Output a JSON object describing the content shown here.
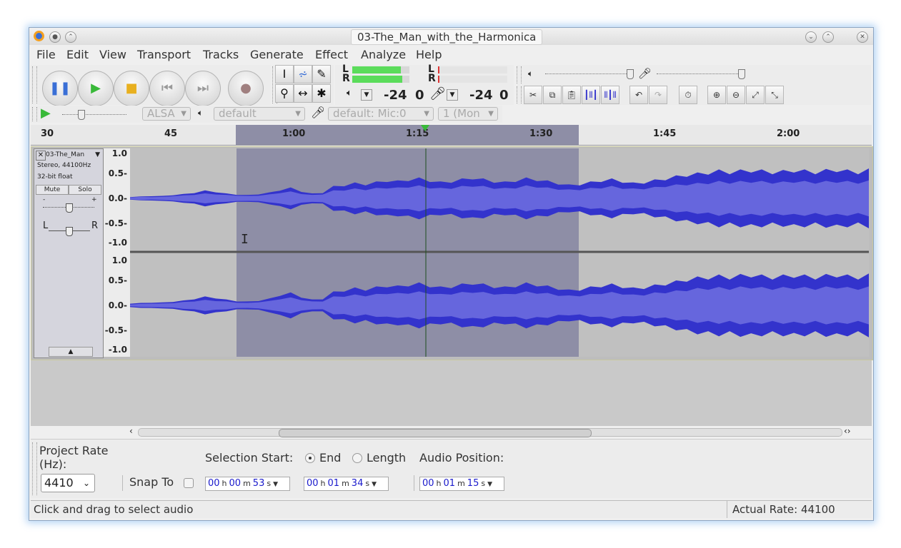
{
  "window": {
    "title": "03-The_Man_with_the_Harmonica"
  },
  "menu": [
    "File",
    "Edit",
    "View",
    "Transport",
    "Tracks",
    "Generate",
    "Effect",
    "Analyze",
    "Help"
  ],
  "meters": {
    "rec_l": "L",
    "rec_r": "R",
    "play_l": "L",
    "play_r": "R",
    "rec_db": "-24",
    "rec_zero": "0",
    "play_db": "-24",
    "play_zero": "0"
  },
  "device": {
    "host": "ALSA",
    "output": "default",
    "input": "default: Mic:0",
    "channels": "1 (Mon"
  },
  "ruler": {
    "ticks": [
      "30",
      "45",
      "1:00",
      "1:15",
      "1:30",
      "1:45",
      "2:00"
    ]
  },
  "track": {
    "name": "03-The_Man",
    "info1": "Stereo, 44100Hz",
    "info2": "32-bit float",
    "mute": "Mute",
    "solo": "Solo",
    "gain_minus": "-",
    "gain_plus": "+",
    "pan_l": "L",
    "pan_r": "R",
    "scale": [
      "1.0",
      "0.5-",
      "0.0-",
      "-0.5-",
      "-1.0"
    ],
    "channels": [
      {
        "peaks": [
          0.03,
          0.04,
          0.05,
          0.05,
          0.07,
          0.09,
          0.12,
          0.16,
          0.14,
          0.1,
          0.08,
          0.07,
          0.09,
          0.12,
          0.18,
          0.22,
          0.15,
          0.1,
          0.12,
          0.25,
          0.28,
          0.32,
          0.3,
          0.34,
          0.38,
          0.36,
          0.4,
          0.42,
          0.38,
          0.34,
          0.36,
          0.4,
          0.44,
          0.4,
          0.36,
          0.34,
          0.38,
          0.42,
          0.4,
          0.36,
          0.32,
          0.28,
          0.3,
          0.34,
          0.38,
          0.4,
          0.36,
          0.32,
          0.34,
          0.38,
          0.42,
          0.46,
          0.5,
          0.52,
          0.55,
          0.58,
          0.56,
          0.58,
          0.6,
          0.58,
          0.56,
          0.57,
          0.6,
          0.58,
          0.56,
          0.59,
          0.61,
          0.58,
          0.56,
          0.6
        ],
        "rms": [
          0.02,
          0.03,
          0.03,
          0.03,
          0.05,
          0.06,
          0.08,
          0.1,
          0.09,
          0.07,
          0.06,
          0.05,
          0.06,
          0.08,
          0.12,
          0.14,
          0.1,
          0.07,
          0.09,
          0.16,
          0.18,
          0.2,
          0.19,
          0.21,
          0.23,
          0.22,
          0.25,
          0.26,
          0.23,
          0.21,
          0.22,
          0.25,
          0.27,
          0.25,
          0.22,
          0.21,
          0.23,
          0.26,
          0.25,
          0.22,
          0.2,
          0.18,
          0.19,
          0.21,
          0.23,
          0.25,
          0.22,
          0.2,
          0.21,
          0.23,
          0.26,
          0.28,
          0.3,
          0.31,
          0.33,
          0.35,
          0.34,
          0.35,
          0.36,
          0.35,
          0.34,
          0.34,
          0.36,
          0.35,
          0.34,
          0.35,
          0.36,
          0.35,
          0.34,
          0.36
        ]
      },
      {
        "peaks": [
          0.04,
          0.05,
          0.06,
          0.06,
          0.08,
          0.1,
          0.14,
          0.18,
          0.16,
          0.12,
          0.09,
          0.08,
          0.1,
          0.14,
          0.22,
          0.26,
          0.18,
          0.12,
          0.14,
          0.28,
          0.32,
          0.36,
          0.34,
          0.38,
          0.42,
          0.4,
          0.44,
          0.46,
          0.42,
          0.38,
          0.4,
          0.44,
          0.48,
          0.44,
          0.4,
          0.38,
          0.42,
          0.46,
          0.44,
          0.4,
          0.36,
          0.32,
          0.34,
          0.38,
          0.42,
          0.44,
          0.4,
          0.36,
          0.38,
          0.42,
          0.46,
          0.5,
          0.55,
          0.58,
          0.6,
          0.62,
          0.6,
          0.63,
          0.65,
          0.62,
          0.6,
          0.62,
          0.64,
          0.62,
          0.6,
          0.63,
          0.65,
          0.62,
          0.6,
          0.64
        ],
        "rms": [
          0.02,
          0.03,
          0.04,
          0.04,
          0.05,
          0.07,
          0.09,
          0.11,
          0.1,
          0.08,
          0.06,
          0.05,
          0.07,
          0.09,
          0.14,
          0.16,
          0.12,
          0.08,
          0.09,
          0.18,
          0.2,
          0.22,
          0.21,
          0.23,
          0.26,
          0.25,
          0.27,
          0.28,
          0.26,
          0.23,
          0.25,
          0.27,
          0.29,
          0.27,
          0.25,
          0.23,
          0.26,
          0.28,
          0.27,
          0.25,
          0.22,
          0.2,
          0.21,
          0.23,
          0.26,
          0.27,
          0.25,
          0.22,
          0.23,
          0.26,
          0.28,
          0.3,
          0.33,
          0.35,
          0.36,
          0.37,
          0.36,
          0.38,
          0.39,
          0.37,
          0.36,
          0.37,
          0.38,
          0.37,
          0.36,
          0.38,
          0.39,
          0.37,
          0.36,
          0.38
        ]
      }
    ]
  },
  "bottom": {
    "project_rate_label": "Project Rate (Hz):",
    "project_rate": "4410",
    "snap_to": "Snap To",
    "selection_start": "Selection Start:",
    "end": "End",
    "length": "Length",
    "audio_position": "Audio Position:",
    "sel_start": {
      "h": "00",
      "m": "00",
      "s": "53"
    },
    "sel_end": {
      "h": "00",
      "m": "01",
      "s": "34"
    },
    "audio_pos": {
      "h": "00",
      "m": "01",
      "s": "15"
    },
    "unit_h": "h",
    "unit_m": "m",
    "unit_s": "s"
  },
  "status": {
    "message": "Click and drag to select audio",
    "actual_rate": "Actual Rate: 44100"
  },
  "colors": {
    "wave": "#3333cc",
    "wave_rms": "#6666dd",
    "selection": "#8e8ea6",
    "track_bg": "#c0c0c0",
    "meter_green": "#5bdc5b"
  }
}
